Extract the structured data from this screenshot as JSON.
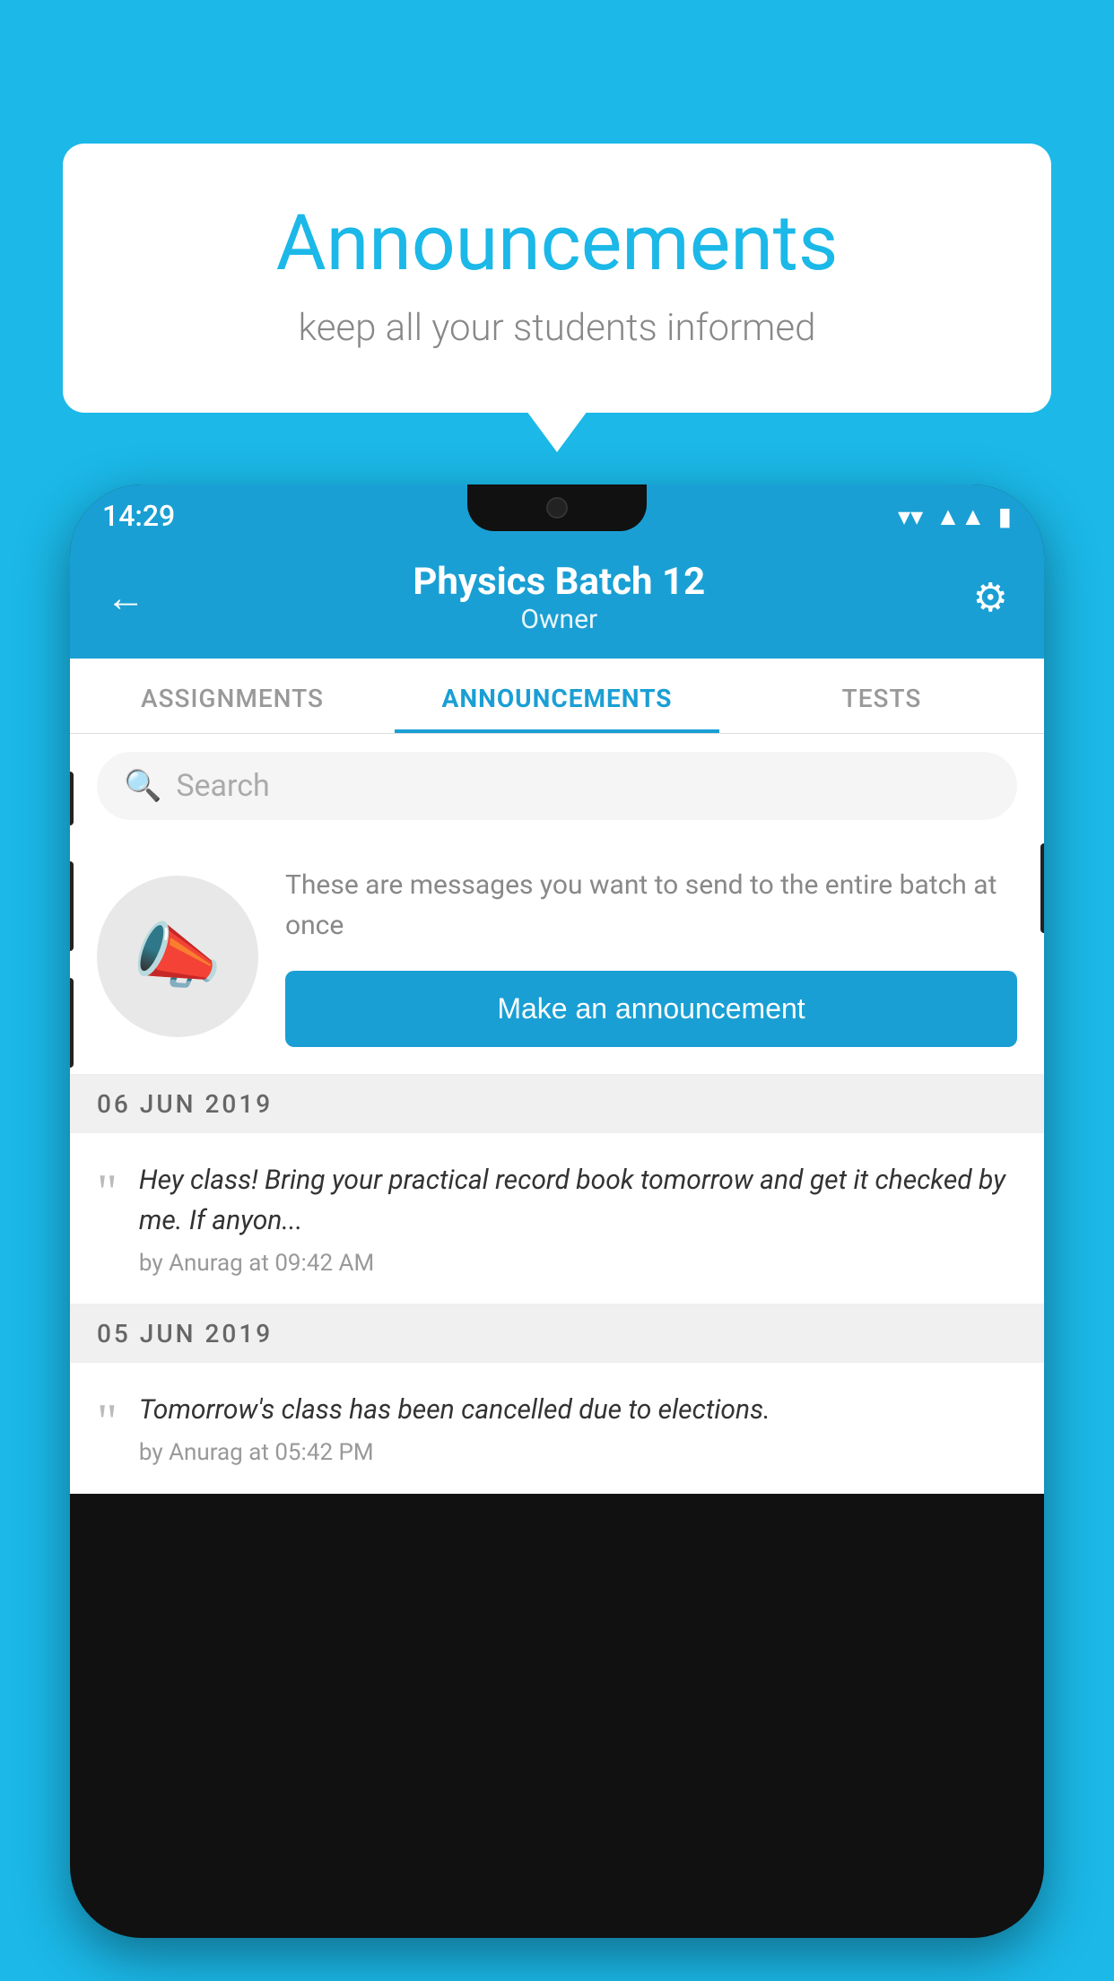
{
  "background_color": "#1BB8E8",
  "speech_bubble": {
    "title": "Announcements",
    "subtitle": "keep all your students informed"
  },
  "phone": {
    "status_bar": {
      "time": "14:29",
      "icons": [
        "wifi",
        "signal",
        "battery"
      ]
    },
    "header": {
      "back_label": "←",
      "title": "Physics Batch 12",
      "subtitle": "Owner",
      "settings_label": "⚙"
    },
    "tabs": [
      {
        "label": "ASSIGNMENTS",
        "active": false
      },
      {
        "label": "ANNOUNCEMENTS",
        "active": true
      },
      {
        "label": "TESTS",
        "active": false
      },
      {
        "label": "...",
        "active": false
      }
    ],
    "search": {
      "placeholder": "Search"
    },
    "announcement_intro": {
      "description": "These are messages you want to send to the entire batch at once",
      "cta_label": "Make an announcement"
    },
    "announcement_groups": [
      {
        "date": "06  JUN  2019",
        "items": [
          {
            "text": "Hey class! Bring your practical record book tomorrow and get it checked by me. If anyon...",
            "meta": "by Anurag at 09:42 AM"
          }
        ]
      },
      {
        "date": "05  JUN  2019",
        "items": [
          {
            "text": "Tomorrow's class has been cancelled due to elections.",
            "meta": "by Anurag at 05:42 PM"
          }
        ]
      }
    ]
  }
}
